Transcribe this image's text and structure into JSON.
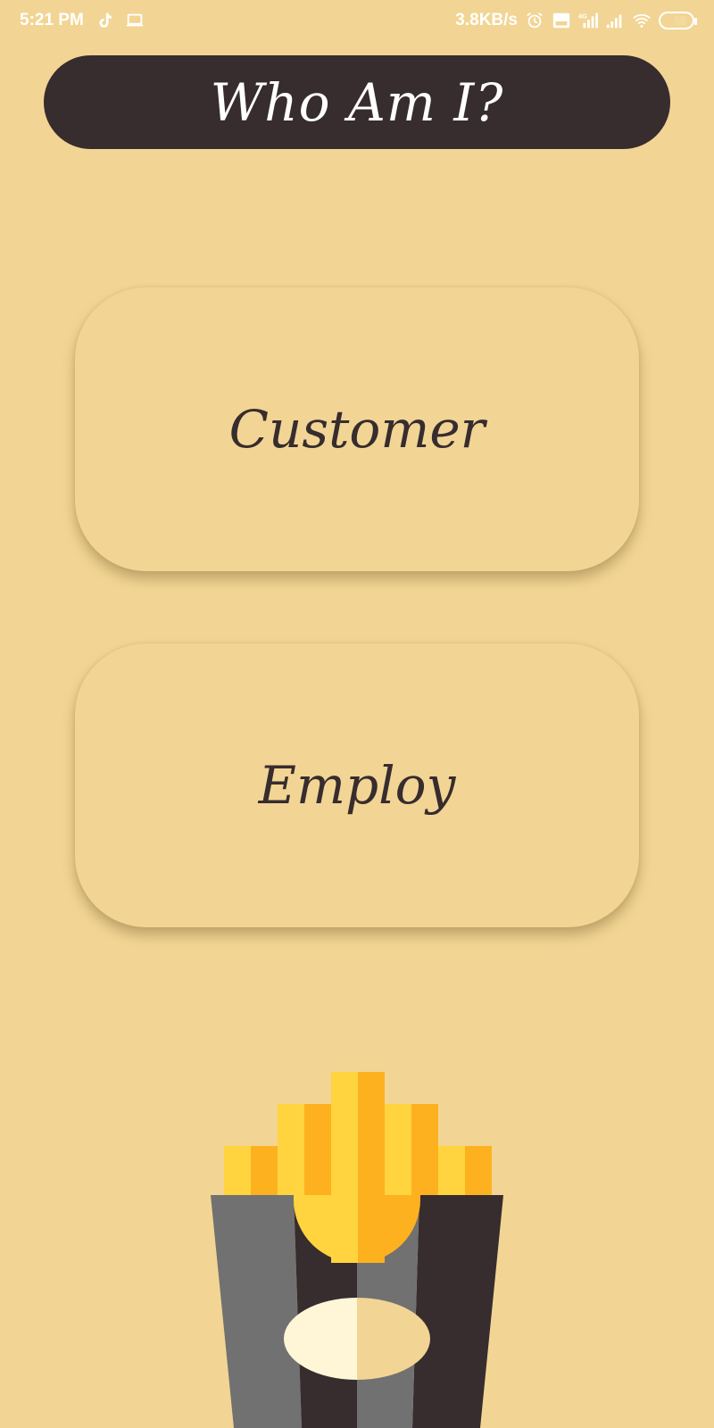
{
  "status_bar": {
    "time": "5:21 PM",
    "network_speed": "3.8KB/s",
    "battery_level": "19",
    "icons": [
      "tiktok-icon",
      "laptop-icon",
      "alarm-icon",
      "volte-icon",
      "signal-4g-icon",
      "signal-icon",
      "wifi-icon",
      "battery-icon"
    ]
  },
  "header": {
    "title": "Who Am I?"
  },
  "roles": [
    {
      "label": "Customer"
    },
    {
      "label": "Employ"
    }
  ],
  "illustration": {
    "name": "fries-illustration"
  },
  "colors": {
    "background": "#F2D594",
    "dark": "#372C2E",
    "fries_light": "#FFD43F",
    "fries_dark": "#FDB11F",
    "box_grey": "#717171",
    "oval_light": "#FFF6D8"
  }
}
